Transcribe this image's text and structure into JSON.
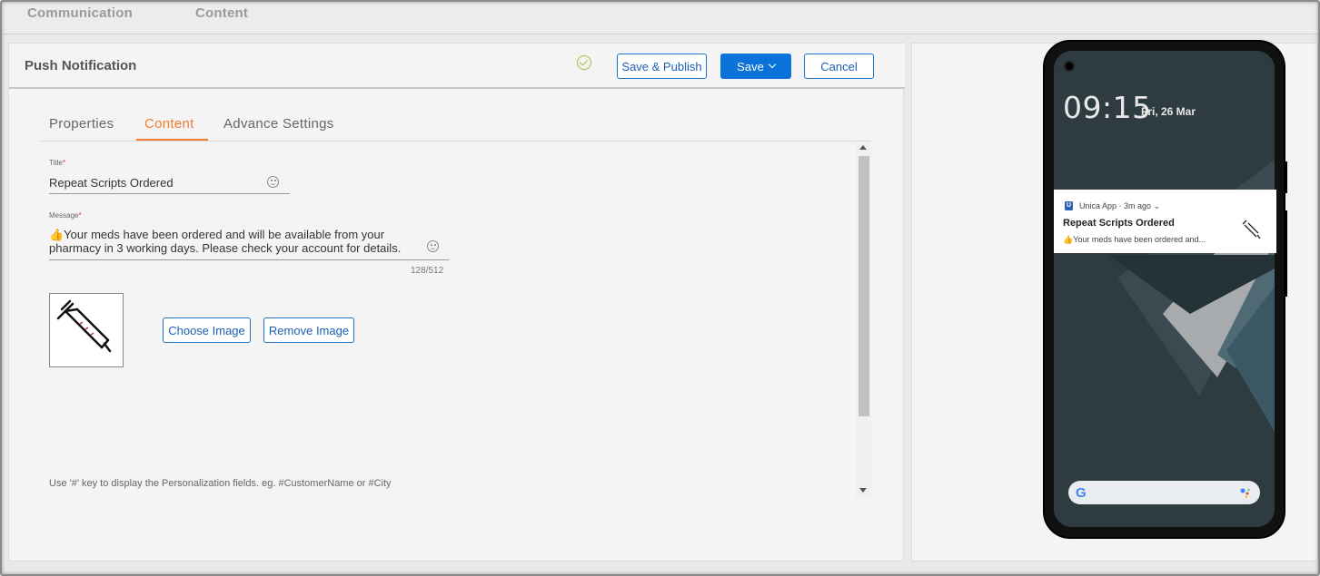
{
  "top_nav": {
    "items": [
      "Communication",
      "Content"
    ]
  },
  "header": {
    "title": "Push Notification",
    "save_publish_label": "Save & Publish",
    "save_label": "Save",
    "cancel_label": "Cancel"
  },
  "tabs": [
    {
      "label": "Properties",
      "active": false
    },
    {
      "label": "Content",
      "active": true
    },
    {
      "label": "Advance Settings",
      "active": false
    }
  ],
  "form": {
    "title_label": "Title",
    "title_value": "Repeat Scripts Ordered",
    "message_label": "Message",
    "message_line1": "👍Your meds have been ordered and will be available from your",
    "message_line2": "pharmacy in 3 working days. Please check your account for details.",
    "char_counter": "128/512",
    "required_marker": "*",
    "choose_image_label": "Choose Image",
    "remove_image_label": "Remove Image",
    "image_icon": "syringe-icon",
    "hint": "Use '#' key to display the Personalization fields. eg. #CustomerName or #City"
  },
  "preview": {
    "time": "09:15",
    "date": "Fri, 26 Mar",
    "notification": {
      "app_name": "Unica App",
      "age": "3m ago",
      "app_icon_letter": "U",
      "title": "Repeat Scripts Ordered",
      "message": "👍Your meds have been ordered and..."
    },
    "search_logo": "G"
  },
  "colors": {
    "accent_orange": "#f07d32",
    "primary_blue": "#0b72d9",
    "check_green": "#a7b93b"
  }
}
